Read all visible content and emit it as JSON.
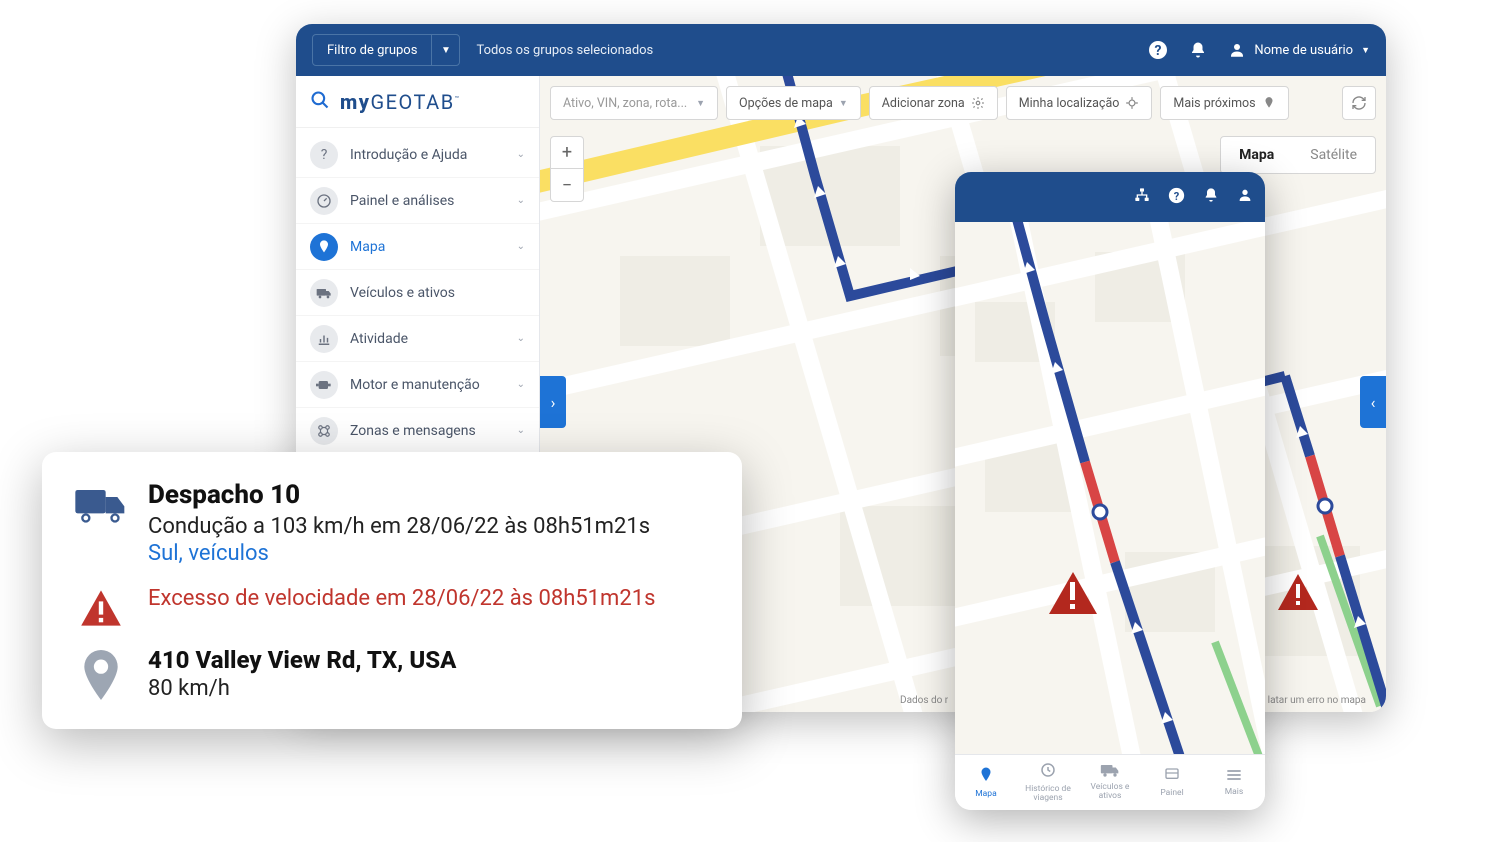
{
  "topbar": {
    "filter_label": "Filtro de grupos",
    "selected_text": "Todos os grupos selecionados",
    "username": "Nome de usuário"
  },
  "brand": {
    "prefix": "my",
    "main": "GEOTAB",
    "tm": "™"
  },
  "sidebar": {
    "items": [
      {
        "label": "Introdução e Ajuda",
        "active": false,
        "chev": true
      },
      {
        "label": "Painel e análises",
        "active": false,
        "chev": true
      },
      {
        "label": "Mapa",
        "active": true,
        "chev": true
      },
      {
        "label": "Veículos e ativos",
        "active": false,
        "chev": false
      },
      {
        "label": "Atividade",
        "active": false,
        "chev": true
      },
      {
        "label": "Motor e manutenção",
        "active": false,
        "chev": true
      },
      {
        "label": "Zonas e mensagens",
        "active": false,
        "chev": true
      }
    ]
  },
  "map_toolbar": {
    "search_placeholder": "Ativo, VIN, zona, rota...",
    "map_options": "Opções de mapa",
    "add_zone": "Adicionar zona",
    "my_location": "Minha localização",
    "nearest": "Mais próximos"
  },
  "maptype": {
    "map": "Mapa",
    "satellite": "Satélite"
  },
  "attrib": {
    "left": "Dados do r",
    "right": "latar um erro no mapa"
  },
  "mobile": {
    "tabs": [
      {
        "label": "Mapa",
        "active": true
      },
      {
        "label": "Histórico de viagens",
        "active": false
      },
      {
        "label": "Veículos e ativos",
        "active": false
      },
      {
        "label": "Painel",
        "active": false
      },
      {
        "label": "Mais",
        "active": false
      }
    ]
  },
  "card": {
    "title": "Despacho 10",
    "driving": "Condução a 103 km/h em 28/06/22 às 08h51m21s",
    "tags": "Sul, veículos",
    "alert": "Excesso de velocidade em 28/06/22 às 08h51m21s",
    "address": "410 Valley View Rd, TX, USA",
    "speed": "80 km/h"
  }
}
